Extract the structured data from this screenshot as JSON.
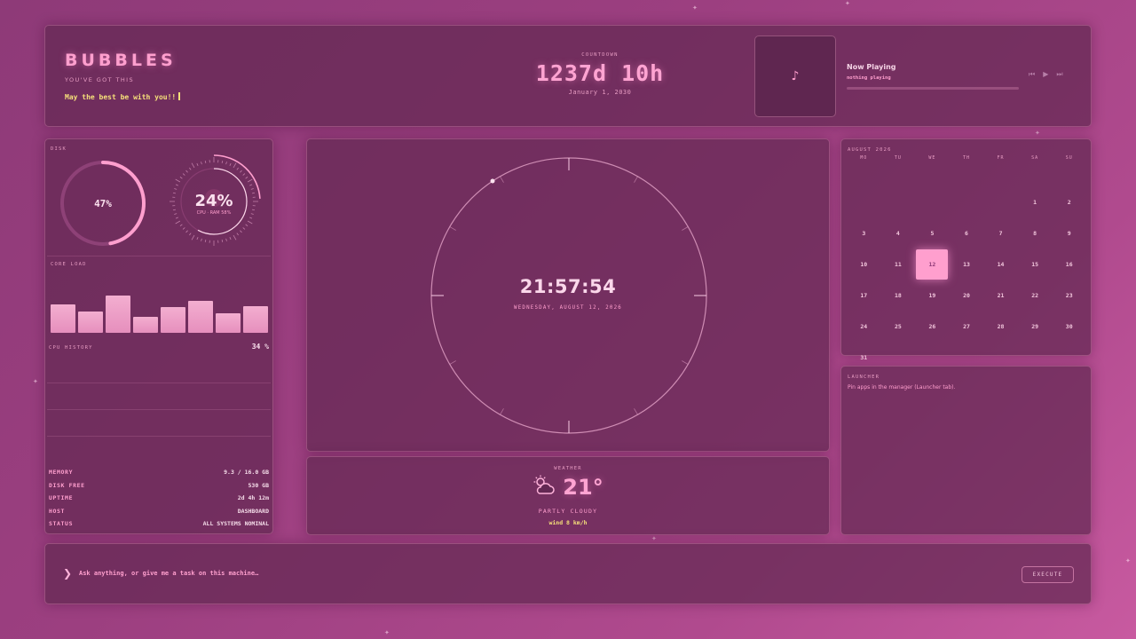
{
  "header": {
    "brand": "BUBBLES",
    "tagline": "YOU'VE GOT THIS",
    "motto": "May the best be with you!!",
    "countdown": {
      "label": "COUNTDOWN",
      "value": "1237d 10h",
      "date": "January 1, 2030"
    },
    "now_playing": {
      "icon": "music-note-icon",
      "title": "Now Playing",
      "subtitle": "nothing playing",
      "progress": 0,
      "controls": [
        "previous-icon",
        "play-icon",
        "next-icon"
      ]
    }
  },
  "stats": {
    "disk_label": "DISK",
    "disk_value": "47%",
    "disk_percent": 47,
    "cpu_value": "24%",
    "cpu_sub": "CPU · RAM 58%",
    "cpu_percent": 24,
    "ram_percent": 58,
    "core_load_label": "CORE LOAD",
    "core_loads": [
      32,
      24,
      42,
      18,
      29,
      36,
      22,
      30
    ],
    "cpu_history_label": "CPU HISTORY",
    "cpu_history_value": "34 %",
    "rows": [
      {
        "key": "MEMORY",
        "value": "9.3 / 16.0 GB"
      },
      {
        "key": "DISK FREE",
        "value": "530 GB"
      },
      {
        "key": "UPTIME",
        "value": "2d 4h 12m"
      },
      {
        "key": "HOST",
        "value": "DASHBOARD"
      },
      {
        "key": "STATUS",
        "value": "ALL SYSTEMS NOMINAL"
      }
    ]
  },
  "clock": {
    "time": "21:57:54",
    "date": "WEDNESDAY, AUGUST 12, 2026"
  },
  "weather": {
    "label": "WEATHER",
    "icon": "partly-cloudy-icon",
    "temp": "21°",
    "condition": "PARTLY CLOUDY",
    "wind": "wind 8 km/h"
  },
  "calendar": {
    "title": "AUGUST 2026",
    "weekdays": [
      "MO",
      "TU",
      "WE",
      "TH",
      "FR",
      "SA",
      "SU"
    ],
    "first_weekday_index": 5,
    "days_in_month": 31,
    "today": 12
  },
  "launcher": {
    "label": "LAUNCHER",
    "hint": "Pin apps in the manager (Launcher tab)."
  },
  "command": {
    "caret": "❯",
    "placeholder": "Ask anything, or give me a task on this machine…",
    "button": "EXECUTE"
  },
  "colors": {
    "accent": "#ff9fce",
    "highlight": "#f6e07a",
    "panel": "#622852"
  }
}
